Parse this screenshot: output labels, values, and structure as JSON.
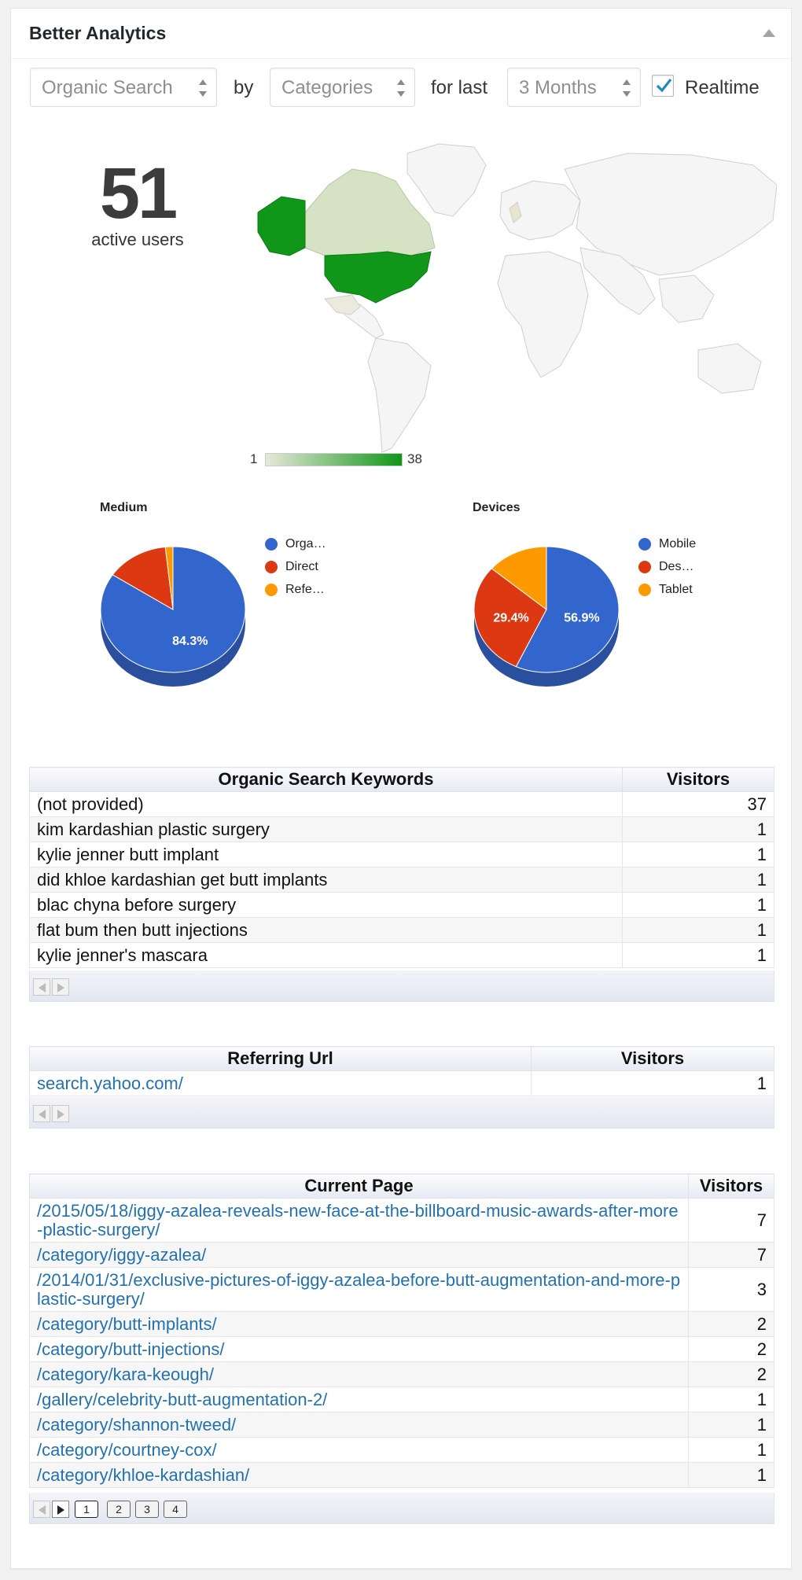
{
  "widget": {
    "title": "Better Analytics"
  },
  "filters": {
    "source": "Organic Search",
    "by_label": "by",
    "dimension": "Categories",
    "for_last_label": "for last",
    "period": "3 Months",
    "realtime_label": "Realtime",
    "realtime_checked": true
  },
  "active_users": {
    "count": "51",
    "label": "active users"
  },
  "map": {
    "legend_min": "1",
    "legend_max": "38",
    "colors": {
      "low": "#e8e8da",
      "high": "#109618",
      "base": "#f5f5f5"
    }
  },
  "medium_chart": {
    "title": "Medium",
    "legend": [
      "Orga…",
      "Direct",
      "Refe…"
    ],
    "slice_label": "84.3%"
  },
  "devices_chart": {
    "title": "Devices",
    "legend": [
      "Mobile",
      "Des…",
      "Tablet"
    ],
    "slice_labels": [
      "56.9%",
      "29.4%"
    ]
  },
  "chart_data": [
    {
      "type": "pie",
      "title": "Medium",
      "categories": [
        "Orga…",
        "Direct",
        "Refe…"
      ],
      "values": [
        84.3,
        14.0,
        1.7
      ],
      "colors": [
        "#3366cc",
        "#dc3912",
        "#ff9900"
      ]
    },
    {
      "type": "pie",
      "title": "Devices",
      "categories": [
        "Mobile",
        "Des…",
        "Tablet"
      ],
      "values": [
        56.9,
        29.4,
        13.7
      ],
      "colors": [
        "#3366cc",
        "#dc3912",
        "#ff9900"
      ]
    }
  ],
  "keywords_table": {
    "headers": [
      "Organic Search Keywords",
      "Visitors"
    ],
    "rows": [
      [
        "(not provided)",
        "37"
      ],
      [
        "kim kardashian plastic surgery",
        "1"
      ],
      [
        "kylie jenner butt implant",
        "1"
      ],
      [
        "did khloe kardashian get butt implants",
        "1"
      ],
      [
        "blac chyna before surgery",
        "1"
      ],
      [
        "flat bum then butt injections",
        "1"
      ],
      [
        "kylie jenner's mascara",
        "1"
      ]
    ]
  },
  "referrer_table": {
    "headers": [
      "Referring Url",
      "Visitors"
    ],
    "rows": [
      [
        "search.yahoo.com/",
        "1"
      ]
    ]
  },
  "pages_table": {
    "headers": [
      "Current Page",
      "Visitors"
    ],
    "rows": [
      [
        "/2015/05/18/iggy-azalea-reveals-new-face-at-the-billboard-music-awards-after-more-plastic-surgery/",
        "7"
      ],
      [
        "/category/iggy-azalea/",
        "7"
      ],
      [
        "/2014/01/31/exclusive-pictures-of-iggy-azalea-before-butt-augmentation-and-more-plastic-surgery/",
        "3"
      ],
      [
        "/category/butt-implants/",
        "2"
      ],
      [
        "/category/butt-injections/",
        "2"
      ],
      [
        "/category/kara-keough/",
        "2"
      ],
      [
        "/gallery/celebrity-butt-augmentation-2/",
        "1"
      ],
      [
        "/category/shannon-tweed/",
        "1"
      ],
      [
        "/category/courtney-cox/",
        "1"
      ],
      [
        "/category/khloe-kardashian/",
        "1"
      ]
    ],
    "pages": [
      "1",
      "2",
      "3",
      "4"
    ]
  }
}
